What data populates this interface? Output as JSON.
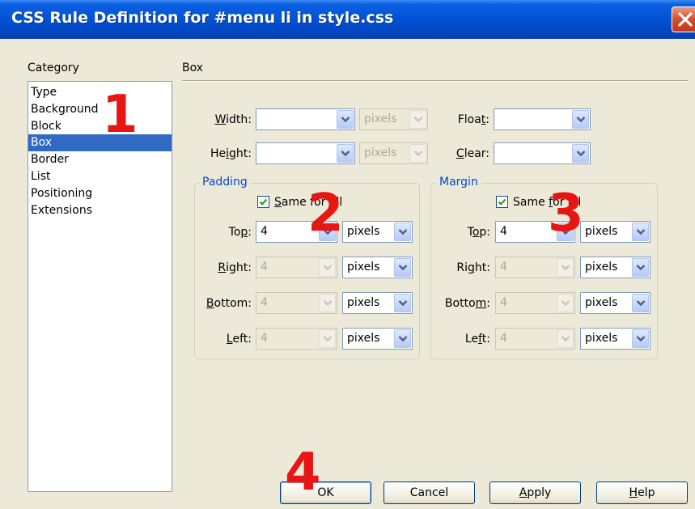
{
  "dialog": {
    "title": "CSS Rule Definition for #menu li in style.css"
  },
  "category": {
    "label": "Category",
    "items": [
      "Type",
      "Background",
      "Block",
      "Box",
      "Border",
      "List",
      "Positioning",
      "Extensions"
    ],
    "selected": "Box"
  },
  "panel": {
    "title": "Box",
    "width": {
      "label_u": "W",
      "label_rest": "idth:",
      "value": "",
      "unit": "pixels"
    },
    "height": {
      "label_pre": "He",
      "label_u": "i",
      "label_rest": "ght:",
      "value": "",
      "unit": "pixels"
    },
    "float": {
      "label_pre": "Floa",
      "label_u": "t",
      "label_rest": ":",
      "value": ""
    },
    "clear": {
      "label_u": "C",
      "label_rest": "lear:",
      "value": ""
    }
  },
  "padding": {
    "title": "Padding",
    "same_for_all": {
      "label_u": "S",
      "label_rest": "ame for all",
      "checked": true
    },
    "top": {
      "label_pre": "To",
      "label_u": "p",
      "label_rest": ":",
      "value": "4",
      "unit": "pixels"
    },
    "right": {
      "label_u": "R",
      "label_rest": "ight:",
      "value": "4",
      "unit": "pixels"
    },
    "bottom": {
      "label_u": "B",
      "label_rest": "ottom:",
      "value": "4",
      "unit": "pixels"
    },
    "left": {
      "label_u": "L",
      "label_rest": "eft:",
      "value": "4",
      "unit": "pixels"
    }
  },
  "margin": {
    "title": "Margin",
    "same_for_all": {
      "label_pre": "Same ",
      "label_u": "f",
      "label_rest": "or all",
      "checked": true
    },
    "top": {
      "label_pre": "T",
      "label_u": "o",
      "label_rest": "p:",
      "value": "4",
      "unit": "pixels"
    },
    "right": {
      "label_pre": "Ri",
      "label_u": "g",
      "label_rest": "ht:",
      "value": "4",
      "unit": "pixels"
    },
    "bottom": {
      "label_pre": "Botto",
      "label_u": "m",
      "label_rest": ":",
      "value": "4",
      "unit": "pixels"
    },
    "left": {
      "label_pre": "Le",
      "label_u": "f",
      "label_rest": "t:",
      "value": "4",
      "unit": "pixels"
    }
  },
  "buttons": {
    "ok": "OK",
    "cancel": "Cancel",
    "apply_u": "A",
    "apply_rest": "pply",
    "help_u": "H",
    "help_rest": "elp"
  },
  "annotations": [
    "1",
    "2",
    "3",
    "4"
  ],
  "colors": {
    "title_bar": "#0354d6",
    "selection": "#316ac5",
    "group_title": "#0046d5",
    "annotation": "#e81612"
  },
  "icons": {
    "dropdown": "chevron-down-icon",
    "close": "close-icon",
    "check": "checkmark-icon"
  }
}
